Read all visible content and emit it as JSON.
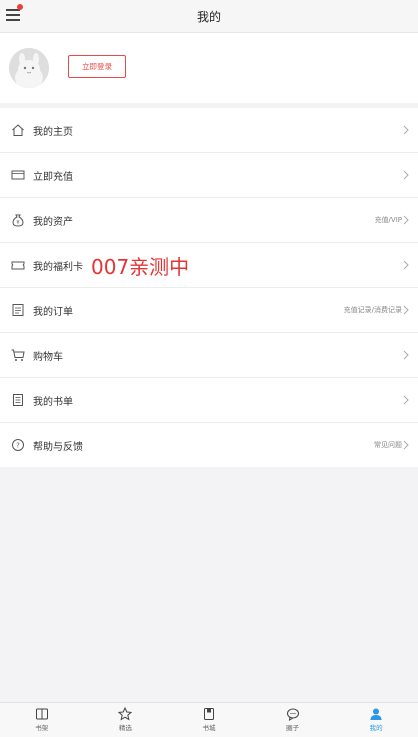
{
  "header": {
    "title": "我的",
    "menu_icon": "menu-icon",
    "notification_dot_color": "#ee3b3b"
  },
  "profile": {
    "avatar_icon": "default-avatar-icon",
    "login_label": "立即登录"
  },
  "menu": {
    "items": [
      {
        "label": "我的主页",
        "icon": "home-icon",
        "right": ""
      },
      {
        "label": "立即充值",
        "icon": "card-icon",
        "right": ""
      },
      {
        "label": "我的资产",
        "icon": "money-bag-icon",
        "right": "充值/VIP"
      },
      {
        "label": "我的福利卡",
        "icon": "ticket-icon",
        "right": ""
      },
      {
        "label": "我的订单",
        "icon": "order-icon",
        "right": "充值记录/消费记录"
      },
      {
        "label": "购物车",
        "icon": "cart-icon",
        "right": ""
      },
      {
        "label": "我的书单",
        "icon": "booklist-icon",
        "right": ""
      },
      {
        "label": "帮助与反馈",
        "icon": "help-icon",
        "right": "常见问题"
      }
    ],
    "overlay_text": "007亲测中"
  },
  "tabbar": {
    "tabs": [
      {
        "label": "书架",
        "icon": "bookshelf-icon"
      },
      {
        "label": "精选",
        "icon": "star-icon"
      },
      {
        "label": "书城",
        "icon": "bookstore-icon"
      },
      {
        "label": "圈子",
        "icon": "chat-icon"
      },
      {
        "label": "我的",
        "icon": "user-icon",
        "active": true
      }
    ],
    "active_color": "#2a97e8"
  }
}
